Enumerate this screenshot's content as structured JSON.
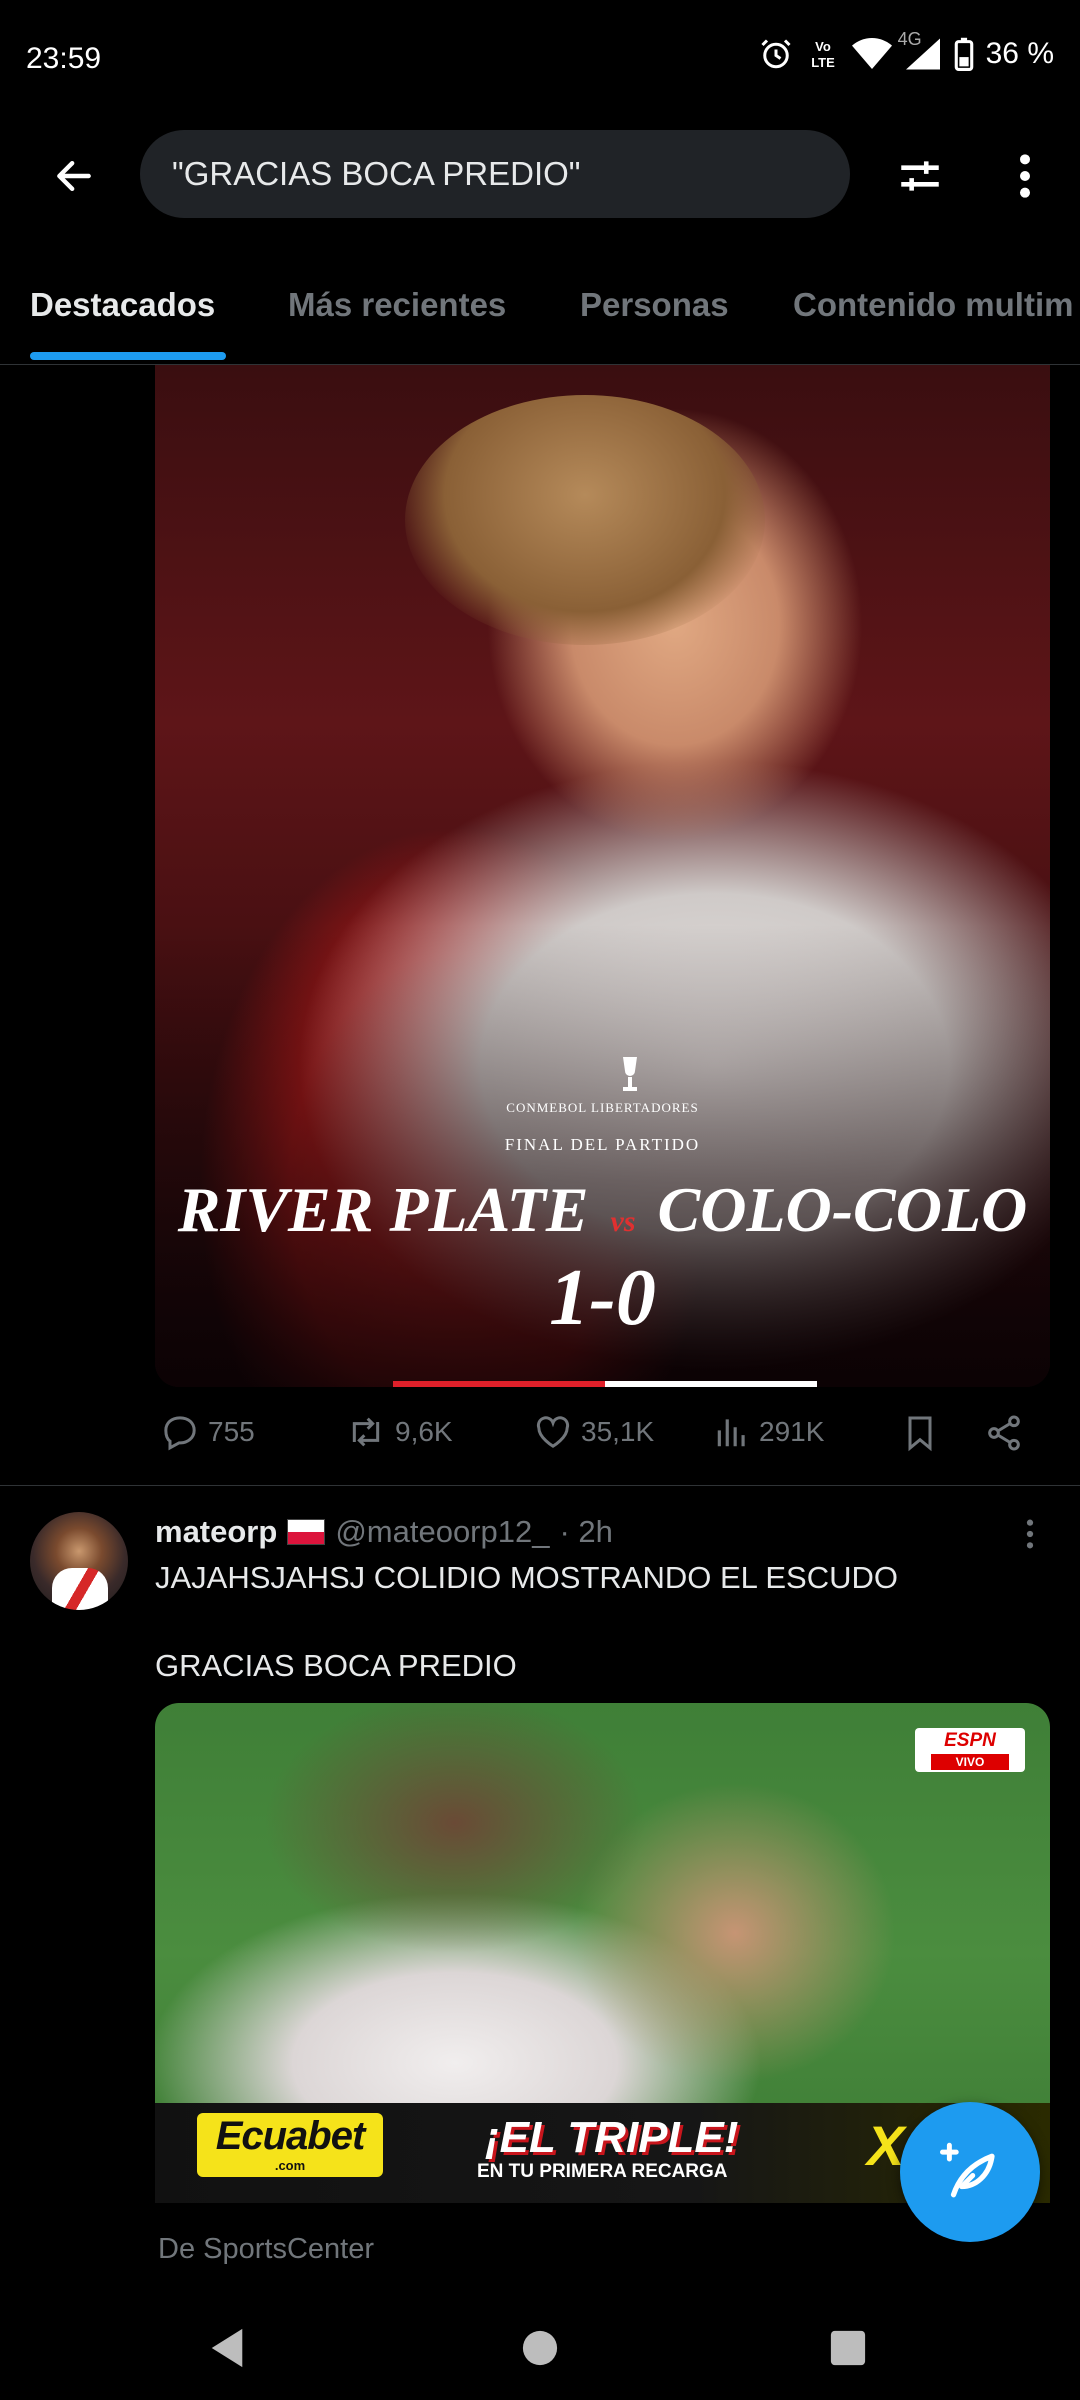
{
  "status_bar": {
    "time": "23:59",
    "network_label": "4G",
    "battery": "36 %"
  },
  "header": {
    "search_query": "\"GRACIAS BOCA PREDIO\"",
    "icons": [
      "back-arrow-icon",
      "filter-sliders-icon",
      "more-vertical-icon"
    ]
  },
  "tabs": [
    {
      "label": "Destacados",
      "active": true
    },
    {
      "label": "Más recientes",
      "active": false
    },
    {
      "label": "Personas",
      "active": false
    },
    {
      "label": "Contenido multim",
      "active": false
    }
  ],
  "post1": {
    "media": {
      "final_label": "FINAL DEL PARTIDO",
      "competition": "CONMEBOL LIBERTADORES",
      "team_home": "RIVER PLATE",
      "vs": "vs",
      "team_away": "COLO-COLO",
      "score": "1-0"
    },
    "actions": {
      "replies": "755",
      "reposts": "9,6K",
      "likes": "35,1K",
      "views": "291K"
    }
  },
  "post2": {
    "author_name": "mateorp",
    "author_handle": "@mateoorp12_",
    "time": "· 2h",
    "text_line1": "JAJAHSJAHSJ COLIDIO MOSTRANDO EL ESCUDO",
    "text_line2": "GRACIAS BOCA PREDIO",
    "media": {
      "broadcaster": "ESPN",
      "live_label": "VIVO",
      "ad_brand": "Ecuabet",
      "ad_brand_domain": ".com",
      "ad_headline": "¡EL TRIPLE!",
      "ad_sub": "EN TU PRIMERA RECARGA",
      "ad_extra": "X"
    },
    "attribution": "De SportsCenter"
  },
  "colors": {
    "accent": "#1d9bf0",
    "background": "#000000",
    "muted_text": "#71767b",
    "divider": "#2f3336"
  }
}
